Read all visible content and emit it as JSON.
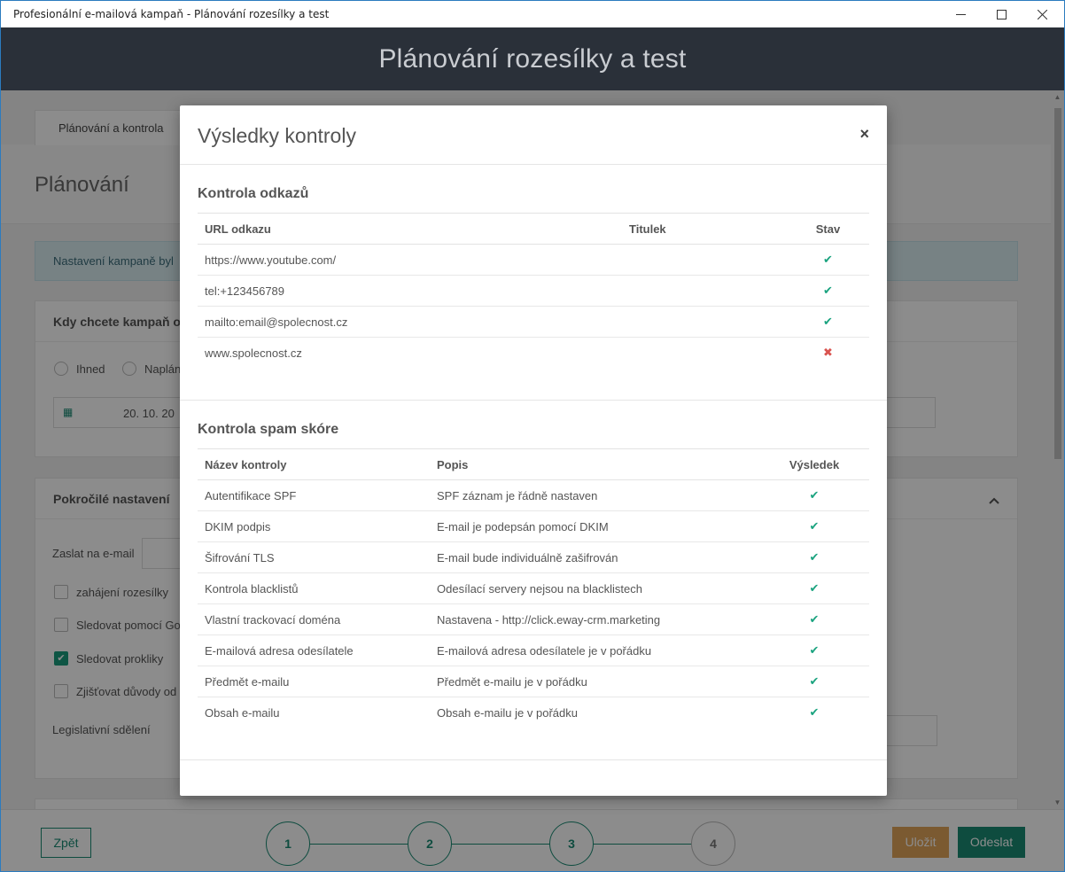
{
  "window": {
    "title": "Profesionální e-mailová kampaň - Plánování rozesílky a test"
  },
  "header": {
    "title": "Plánování rozesílky a test"
  },
  "background": {
    "tab": "Plánování a kontrola",
    "page_title": "Plánování",
    "alert": "Nastavení kampaně byl",
    "card1": {
      "title": "Kdy chcete kampaň o",
      "radio_now": "Ihned",
      "radio_planned": "Naplán",
      "date_value": "20. 10. 20"
    },
    "card2": {
      "title": "Pokročilé nastavení",
      "email_label": "Zaslat na e-mail",
      "chk1": "zahájení rozesílky",
      "chk2": "Sledovat pomocí Go",
      "chk3": "Sledovat prokliky",
      "chk4": "Zjišťovat důvody od",
      "legal": "Legislativní sdělení"
    }
  },
  "footer": {
    "back": "Zpět",
    "steps": [
      "1",
      "2",
      "3",
      "4"
    ],
    "save": "Uložit",
    "send": "Odeslat"
  },
  "modal": {
    "title": "Výsledky kontroly",
    "close": "×",
    "links_section": {
      "title": "Kontrola odkazů",
      "headers": [
        "URL odkazu",
        "Titulek",
        "Stav"
      ],
      "rows": [
        {
          "url": "https://www.youtube.com/",
          "title": "",
          "ok": true
        },
        {
          "url": "tel:+123456789",
          "title": "",
          "ok": true
        },
        {
          "url": "mailto:email@spolecnost.cz",
          "title": "",
          "ok": true
        },
        {
          "url": "www.spolecnost.cz",
          "title": "",
          "ok": false
        }
      ]
    },
    "spam_section": {
      "title": "Kontrola spam skóre",
      "headers": [
        "Název kontroly",
        "Popis",
        "Výsledek"
      ],
      "rows": [
        {
          "name": "Autentifikace SPF",
          "desc": "SPF záznam je řádně nastaven",
          "ok": true
        },
        {
          "name": "DKIM podpis",
          "desc": "E-mail je podepsán pomocí DKIM",
          "ok": true
        },
        {
          "name": "Šifrování TLS",
          "desc": "E-mail bude individuálně zašifrován",
          "ok": true
        },
        {
          "name": "Kontrola blacklistů",
          "desc": "Odesílací servery nejsou na blacklistech",
          "ok": true
        },
        {
          "name": "Vlastní trackovací doména",
          "desc": "Nastavena - http://click.eway-crm.marketing",
          "ok": true
        },
        {
          "name": "E-mailová adresa odesílatele",
          "desc": "E-mailová adresa odesílatele je v pořádku",
          "ok": true
        },
        {
          "name": "Předmět e-mailu",
          "desc": "Předmět e-mailu je v pořádku",
          "ok": true
        },
        {
          "name": "Obsah e-mailu",
          "desc": "Obsah e-mailu je v pořádku",
          "ok": true
        }
      ]
    },
    "check_glyph": "✔",
    "cross_glyph": "✖"
  },
  "colors": {
    "header_bg": "#2a3039",
    "accent": "#1a8a74",
    "ok": "#1aa37f",
    "error": "#d9534f",
    "link": "#2a7ec9",
    "save": "#e0a45a"
  }
}
